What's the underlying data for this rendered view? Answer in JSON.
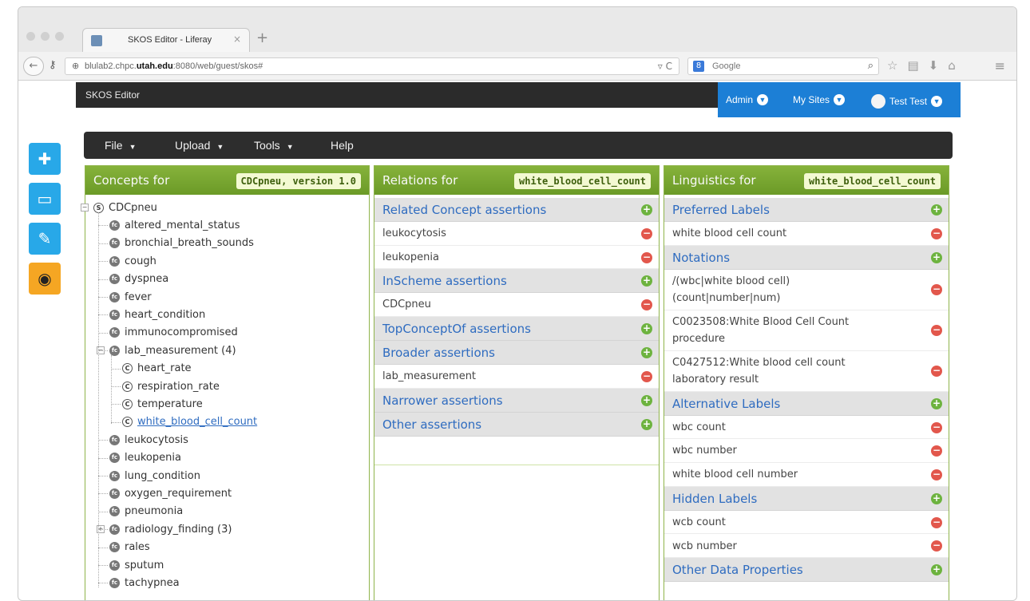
{
  "browser": {
    "tab_title": "SKOS Editor - Liferay",
    "tab_close": "×",
    "new_tab": "+",
    "url_prefix": "blulab2.chpc.",
    "url_host_bold": "utah.edu",
    "url_suffix": ":8080/web/guest/skos#",
    "search_engine_label": "Google",
    "url_reload": "C"
  },
  "dockbar": {
    "title": "SKOS Editor",
    "admin": "Admin",
    "my_sites": "My Sites",
    "user": "Test Test"
  },
  "menubar": {
    "file": "File",
    "upload": "Upload",
    "tools": "Tools",
    "help": "Help"
  },
  "concepts_panel": {
    "title": "Concepts for",
    "badge": "CDCpneu, version 1.0",
    "tree": [
      {
        "label": "CDCpneu",
        "icon": "S",
        "level": 0,
        "expander": "−"
      },
      {
        "label": "altered_mental_status",
        "icon": "fc",
        "level": 1
      },
      {
        "label": "bronchial_breath_sounds",
        "icon": "fc",
        "level": 1
      },
      {
        "label": "cough",
        "icon": "fc",
        "level": 1
      },
      {
        "label": "dyspnea",
        "icon": "fc",
        "level": 1
      },
      {
        "label": "fever",
        "icon": "fc",
        "level": 1
      },
      {
        "label": "heart_condition",
        "icon": "fc",
        "level": 1
      },
      {
        "label": "immunocompromised",
        "icon": "fc",
        "level": 1
      },
      {
        "label": "lab_measurement (4)",
        "icon": "fc",
        "level": 1,
        "expander": "−"
      },
      {
        "label": "heart_rate",
        "icon": "C",
        "level": 2
      },
      {
        "label": "respiration_rate",
        "icon": "C",
        "level": 2
      },
      {
        "label": "temperature",
        "icon": "C",
        "level": 2
      },
      {
        "label": "white_blood_cell_count",
        "icon": "C",
        "level": 2,
        "selected": true
      },
      {
        "label": "leukocytosis",
        "icon": "fc",
        "level": 1
      },
      {
        "label": "leukopenia",
        "icon": "fc",
        "level": 1
      },
      {
        "label": "lung_condition",
        "icon": "fc",
        "level": 1
      },
      {
        "label": "oxygen_requirement",
        "icon": "fc",
        "level": 1
      },
      {
        "label": "pneumonia",
        "icon": "fc",
        "level": 1
      },
      {
        "label": "radiology_finding (3)",
        "icon": "fc",
        "level": 1,
        "expander": "+"
      },
      {
        "label": "rales",
        "icon": "fc",
        "level": 1
      },
      {
        "label": "sputum",
        "icon": "fc",
        "level": 1
      },
      {
        "label": "tachypnea",
        "icon": "fc",
        "level": 1
      }
    ]
  },
  "relations_panel": {
    "title": "Relations for",
    "badge": "white_blood_cell_count",
    "sections": [
      {
        "title": "Related Concept assertions",
        "items": [
          "leukocytosis",
          "leukopenia"
        ]
      },
      {
        "title": "InScheme assertions",
        "items": [
          "CDCpneu"
        ]
      },
      {
        "title": "TopConceptOf assertions",
        "items": []
      },
      {
        "title": "Broader assertions",
        "items": [
          "lab_measurement"
        ]
      },
      {
        "title": "Narrower assertions",
        "items": []
      },
      {
        "title": "Other assertions",
        "items": []
      }
    ]
  },
  "linguistics_panel": {
    "title": "Linguistics for",
    "badge": "white_blood_cell_count",
    "sections": [
      {
        "title": "Preferred Labels",
        "items": [
          "white blood cell count"
        ]
      },
      {
        "title": "Notations",
        "items": [
          "/(wbc|white blood cell)\n(count|number|num)",
          "C0023508:White Blood Cell Count\nprocedure",
          "C0427512:White blood cell count\nlaboratory result"
        ]
      },
      {
        "title": "Alternative Labels",
        "items": [
          "wbc count",
          "wbc number",
          "white blood cell number"
        ]
      },
      {
        "title": "Hidden Labels",
        "items": [
          "wcb count",
          "wcb number"
        ]
      },
      {
        "title": "Other Data Properties",
        "items": []
      }
    ]
  },
  "colors": {
    "panel_green": "#7aa830",
    "link_blue": "#2f6cc0",
    "dock_blue": "#1c7fd6",
    "add_green": "#6db33f",
    "remove_red": "#e2574c"
  }
}
